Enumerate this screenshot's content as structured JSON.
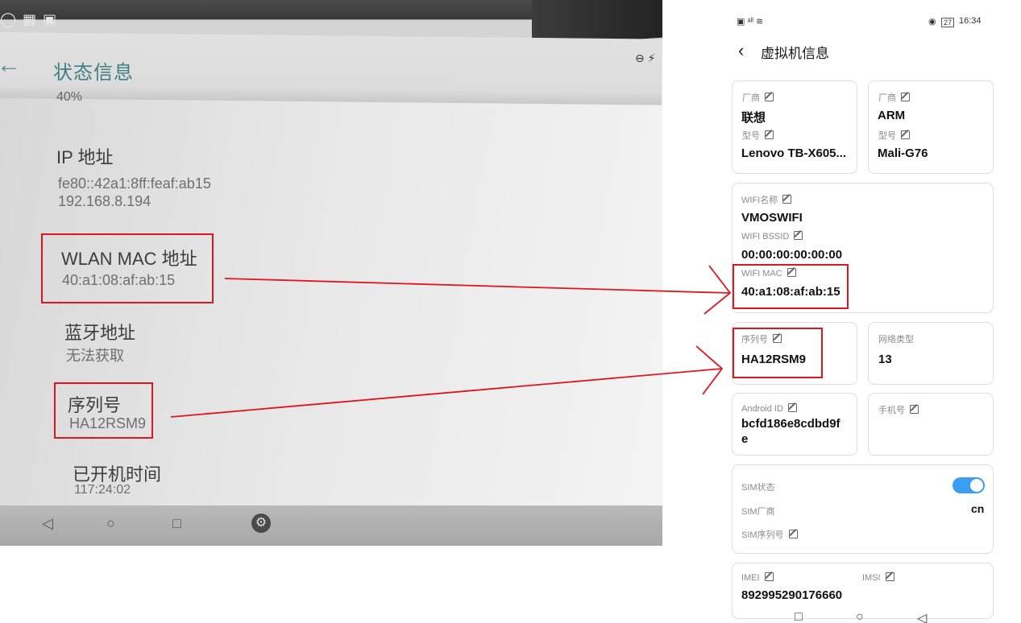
{
  "left_photo": {
    "title": "状态信息",
    "cut_off_text": "40%",
    "items": [
      {
        "title": "IP 地址",
        "values": [
          "fe80::42a1:8ff:feaf:ab15",
          "192.168.8.194"
        ]
      },
      {
        "title": "WLAN MAC 地址",
        "values": [
          "40:a1:08:af:ab:15"
        ]
      },
      {
        "title": "蓝牙地址",
        "values": [
          "无法获取"
        ]
      },
      {
        "title": "序列号",
        "values": [
          "HA12RSM9"
        ]
      },
      {
        "title": "已开机时间",
        "values": [
          "117:24:02"
        ]
      }
    ]
  },
  "phone": {
    "status_time": "16:34",
    "status_battery": "27",
    "page_title": "虚拟机信息",
    "cards": {
      "cpu_left": {
        "vendor_label": "厂商",
        "vendor": "联想",
        "model_label": "型号",
        "model": "Lenovo TB-X605..."
      },
      "cpu_right": {
        "vendor_label": "厂商",
        "vendor": "ARM",
        "model_label": "型号",
        "model": "Mali-G76"
      },
      "wifi": {
        "name_label": "WIFI名称",
        "name": "VMOSWIFI",
        "bssid_label": "WIFI BSSID",
        "bssid": "00:00:00:00:00:00",
        "mac_label": "WIFI MAC",
        "mac": "40:a1:08:af:ab:15"
      },
      "serial": {
        "label": "序列号",
        "value": "HA12RSM9"
      },
      "network": {
        "label": "网络类型",
        "value": "13"
      },
      "android": {
        "label": "Android ID",
        "value_line1": "bcfd186e8cdbd9f",
        "value_line2": "e"
      },
      "phone_number": {
        "label": "手机号",
        "value": ""
      },
      "sim": {
        "status_label": "SIM状态",
        "status_on": true,
        "vendor_label": "SIM厂商",
        "vendor": "cn",
        "serial_label": "SIM序列号"
      },
      "imei": {
        "imei_label": "IMEI",
        "imsi_label": "IMSI",
        "imei": "892995290176660"
      }
    }
  },
  "colors": {
    "highlight": "#e0161c",
    "toggle": "#3b9ef0",
    "photo_title": "#3f7f83"
  }
}
